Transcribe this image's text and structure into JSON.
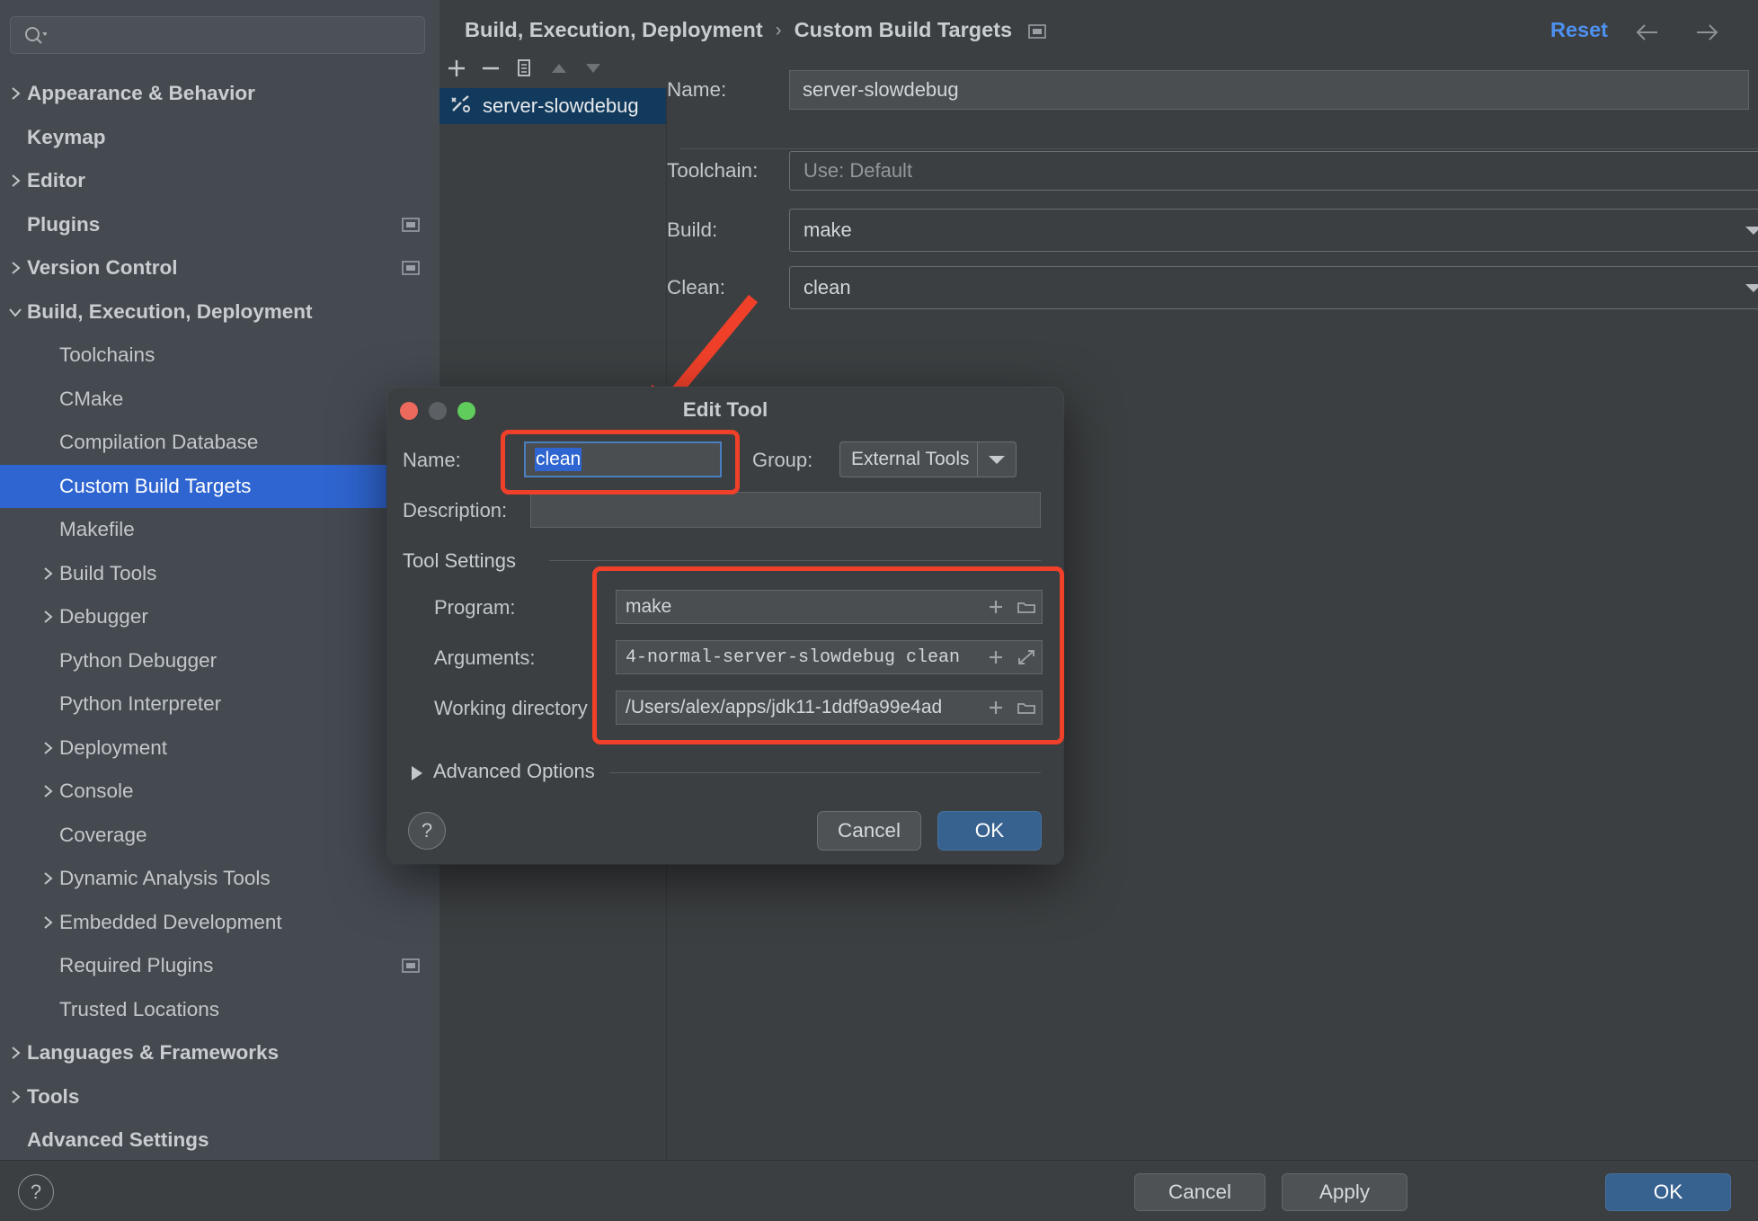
{
  "sidebar": {
    "search": {
      "value": "",
      "placeholder": ""
    },
    "items": [
      {
        "label": "Appearance & Behavior",
        "level": 0,
        "arrow": "right",
        "badge": false,
        "selected": false
      },
      {
        "label": "Keymap",
        "level": 0,
        "arrow": "none",
        "badge": false,
        "selected": false
      },
      {
        "label": "Editor",
        "level": 0,
        "arrow": "right",
        "badge": false,
        "selected": false
      },
      {
        "label": "Plugins",
        "level": 0,
        "arrow": "none",
        "badge": true,
        "selected": false
      },
      {
        "label": "Version Control",
        "level": 0,
        "arrow": "right",
        "badge": true,
        "selected": false
      },
      {
        "label": "Build, Execution, Deployment",
        "level": 0,
        "arrow": "down",
        "badge": false,
        "selected": false
      },
      {
        "label": "Toolchains",
        "level": 1,
        "arrow": "none",
        "badge": false,
        "selected": false
      },
      {
        "label": "CMake",
        "level": 1,
        "arrow": "none",
        "badge": true,
        "selected": false
      },
      {
        "label": "Compilation Database",
        "level": 1,
        "arrow": "none",
        "badge": true,
        "selected": false
      },
      {
        "label": "Custom Build Targets",
        "level": 1,
        "arrow": "none",
        "badge": true,
        "selected": true
      },
      {
        "label": "Makefile",
        "level": 1,
        "arrow": "none",
        "badge": true,
        "selected": false
      },
      {
        "label": "Build Tools",
        "level": 1,
        "arrow": "right",
        "badge": true,
        "selected": false
      },
      {
        "label": "Debugger",
        "level": 1,
        "arrow": "right",
        "badge": false,
        "selected": false
      },
      {
        "label": "Python Debugger",
        "level": 1,
        "arrow": "none",
        "badge": true,
        "selected": false
      },
      {
        "label": "Python Interpreter",
        "level": 1,
        "arrow": "none",
        "badge": true,
        "selected": false
      },
      {
        "label": "Deployment",
        "level": 1,
        "arrow": "right",
        "badge": true,
        "selected": false
      },
      {
        "label": "Console",
        "level": 1,
        "arrow": "right",
        "badge": true,
        "selected": false
      },
      {
        "label": "Coverage",
        "level": 1,
        "arrow": "none",
        "badge": true,
        "selected": false
      },
      {
        "label": "Dynamic Analysis Tools",
        "level": 1,
        "arrow": "right",
        "badge": false,
        "selected": false
      },
      {
        "label": "Embedded Development",
        "level": 1,
        "arrow": "right",
        "badge": false,
        "selected": false
      },
      {
        "label": "Required Plugins",
        "level": 1,
        "arrow": "none",
        "badge": true,
        "selected": false
      },
      {
        "label": "Trusted Locations",
        "level": 1,
        "arrow": "none",
        "badge": false,
        "selected": false
      },
      {
        "label": "Languages & Frameworks",
        "level": 0,
        "arrow": "right",
        "badge": false,
        "selected": false
      },
      {
        "label": "Tools",
        "level": 0,
        "arrow": "right",
        "badge": false,
        "selected": false
      },
      {
        "label": "Advanced Settings",
        "level": 0,
        "arrow": "none",
        "badge": false,
        "selected": false
      }
    ]
  },
  "header": {
    "breadcrumb_parent": "Build, Execution, Deployment",
    "breadcrumb_sep": "›",
    "breadcrumb_current": "Custom Build Targets",
    "reset_label": "Reset"
  },
  "targets": {
    "toolbar": [
      "add-icon",
      "remove-icon",
      "copy-icon",
      "move-up-icon",
      "move-down-icon"
    ],
    "selected_item": "server-slowdebug"
  },
  "form": {
    "name_label": "Name:",
    "name_value": "server-slowdebug",
    "toolchain_label": "Toolchain:",
    "toolchain_value": "Use: Default",
    "build_label": "Build:",
    "build_value": "make",
    "clean_label": "Clean:",
    "clean_value": "clean",
    "ellipsis_label": "..."
  },
  "dialog": {
    "title": "Edit Tool",
    "name_label": "Name:",
    "name_value": "clean",
    "group_label": "Group:",
    "group_value": "External Tools",
    "description_label": "Description:",
    "description_value": "",
    "tool_settings_title": "Tool Settings",
    "program_label": "Program:",
    "program_value": "make",
    "arguments_label": "Arguments:",
    "arguments_value": "4-normal-server-slowdebug clean",
    "working_dir_label": "Working directory",
    "working_dir_value": "/Users/alex/apps/jdk11-1ddf9a99e4ad",
    "advanced_options_label": "Advanced Options",
    "help_label": "?",
    "cancel_label": "Cancel",
    "ok_label": "OK"
  },
  "bottombar": {
    "help_label": "?",
    "cancel_label": "Cancel",
    "apply_label": "Apply",
    "ok_label": "OK"
  },
  "annotations": {
    "accent_color": "#f0402a",
    "highlight_name_field": true,
    "highlight_tool_fields": true,
    "arrow_points_to": "dialog-name-field"
  },
  "colors": {
    "selection_blue": "#2f65d0",
    "accent_link": "#4d90f0",
    "primary_button": "#37618f",
    "sidebar_bg": "#454a51",
    "pane_bg": "#3c3f41"
  }
}
